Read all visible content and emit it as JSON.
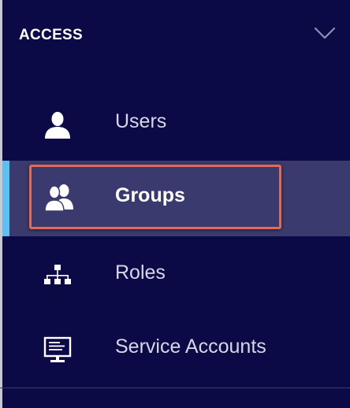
{
  "section": {
    "title": "ACCESS",
    "collapse_icon": "chevron-down-icon"
  },
  "nav": {
    "items": [
      {
        "label": "Users",
        "icon": "user-icon",
        "active": false
      },
      {
        "label": "Groups",
        "icon": "groups-icon",
        "active": true
      },
      {
        "label": "Roles",
        "icon": "hierarchy-icon",
        "active": false
      },
      {
        "label": "Service Accounts",
        "icon": "monitor-icon",
        "active": false
      }
    ]
  },
  "colors": {
    "background": "#0b0a47",
    "active_background": "#3a3a6e",
    "active_indicator": "#5cc0f0",
    "highlight_border": "#e56a55",
    "text": "#d6d6e6"
  }
}
